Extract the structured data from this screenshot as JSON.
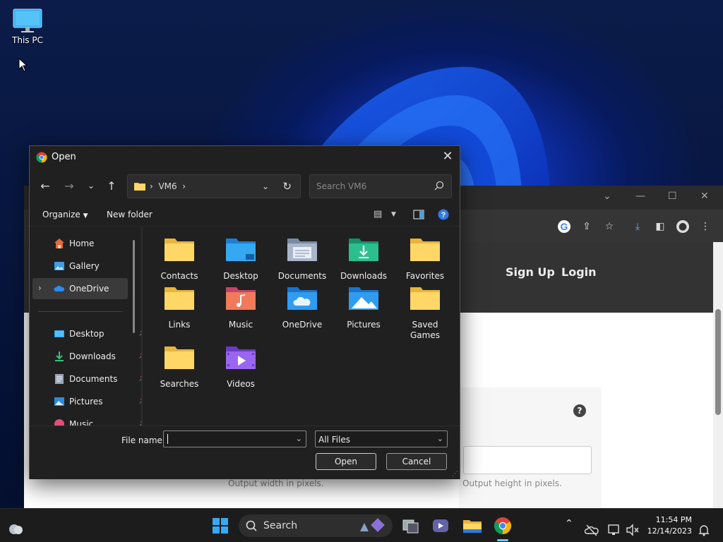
{
  "desktop": {
    "icons": [
      {
        "label": "This PC",
        "icon": "monitor-icon"
      }
    ]
  },
  "chrome": {
    "nav": {
      "signup": "Sign Up",
      "login": "Login"
    },
    "help": "?",
    "hints": {
      "width": "Output width in pixels.",
      "height": "Output height in pixels."
    }
  },
  "dialog": {
    "title": "Open",
    "breadcrumb": "VM6",
    "search_placeholder": "Search VM6",
    "organize": "Organize",
    "new_folder": "New folder",
    "sidebar": [
      {
        "label": "Home",
        "icon": "home-icon"
      },
      {
        "label": "Gallery",
        "icon": "gallery-icon"
      },
      {
        "label": "OneDrive",
        "icon": "onedrive-icon"
      },
      {
        "label": "Desktop",
        "icon": "desktop-icon"
      },
      {
        "label": "Downloads",
        "icon": "downloads-icon"
      },
      {
        "label": "Documents",
        "icon": "documents-icon"
      },
      {
        "label": "Pictures",
        "icon": "pictures-icon"
      },
      {
        "label": "Music",
        "icon": "music-icon"
      }
    ],
    "files": [
      {
        "label": "Contacts",
        "type": "folder-icon"
      },
      {
        "label": "Desktop",
        "type": "desktop-folder-icon"
      },
      {
        "label": "Documents",
        "type": "documents-folder-icon"
      },
      {
        "label": "Downloads",
        "type": "downloads-folder-icon"
      },
      {
        "label": "Favorites",
        "type": "folder-icon"
      },
      {
        "label": "Links",
        "type": "folder-icon"
      },
      {
        "label": "Music",
        "type": "music-folder-icon"
      },
      {
        "label": "OneDrive",
        "type": "onedrive-folder-icon"
      },
      {
        "label": "Pictures",
        "type": "pictures-folder-icon"
      },
      {
        "label": "Saved\nGames",
        "type": "folder-icon"
      },
      {
        "label": "Searches",
        "type": "folder-icon"
      },
      {
        "label": "Videos",
        "type": "videos-folder-icon"
      }
    ],
    "file_name_label": "File name:",
    "file_name_value": "",
    "filter": "All Files",
    "open_label": "Open",
    "cancel_label": "Cancel"
  },
  "taskbar": {
    "search_placeholder": "Search",
    "time": "11:54 PM",
    "date": "12/14/2023"
  }
}
